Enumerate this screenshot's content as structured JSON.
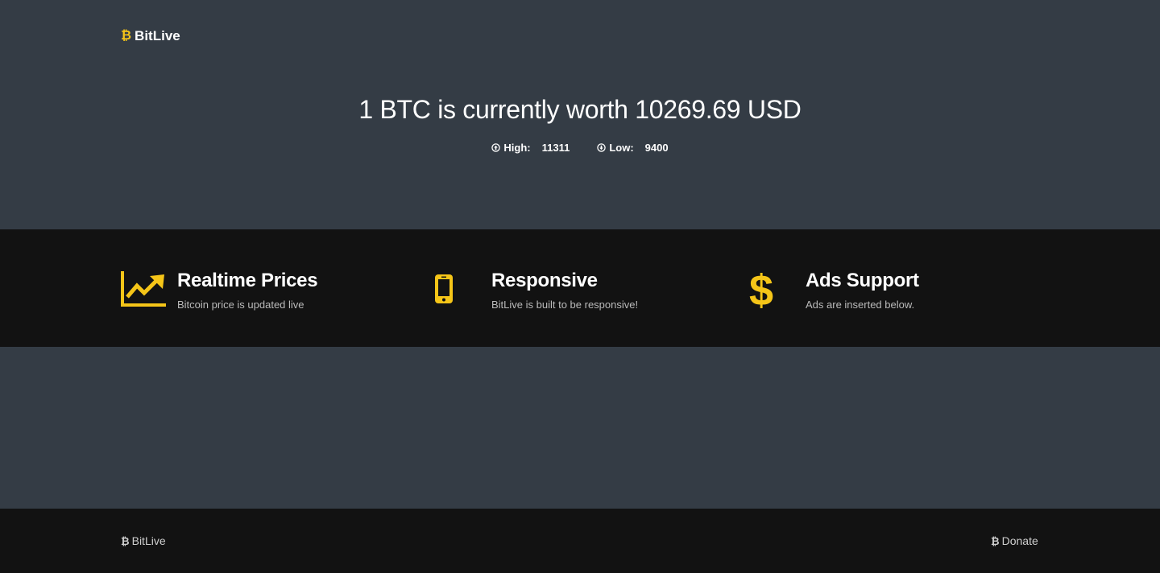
{
  "header": {
    "brand_icon": "bitcoin-icon",
    "brand_label": "BitLive"
  },
  "hero": {
    "headline": "1 BTC is currently worth 10269.69 USD",
    "high_label": "High:",
    "high_value": "11311",
    "low_label": "Low:",
    "low_value": "9400",
    "high_icon": "arrow-circle-up-icon",
    "low_icon": "arrow-circle-down-icon"
  },
  "features": [
    {
      "icon": "trending-up-chart-icon",
      "title": "Realtime Prices",
      "desc": "Bitcoin price is updated live"
    },
    {
      "icon": "mobile-phone-icon",
      "title": "Responsive",
      "desc": "BitLive is built to be responsive!"
    },
    {
      "icon": "dollar-sign-icon",
      "title": "Ads Support",
      "desc": "Ads are inserted below."
    }
  ],
  "footer": {
    "brand_label": "BitLive",
    "donate_label": "Donate"
  },
  "colors": {
    "accent": "#f5c518",
    "hero_bg": "#343c45",
    "band_bg": "#121212"
  }
}
